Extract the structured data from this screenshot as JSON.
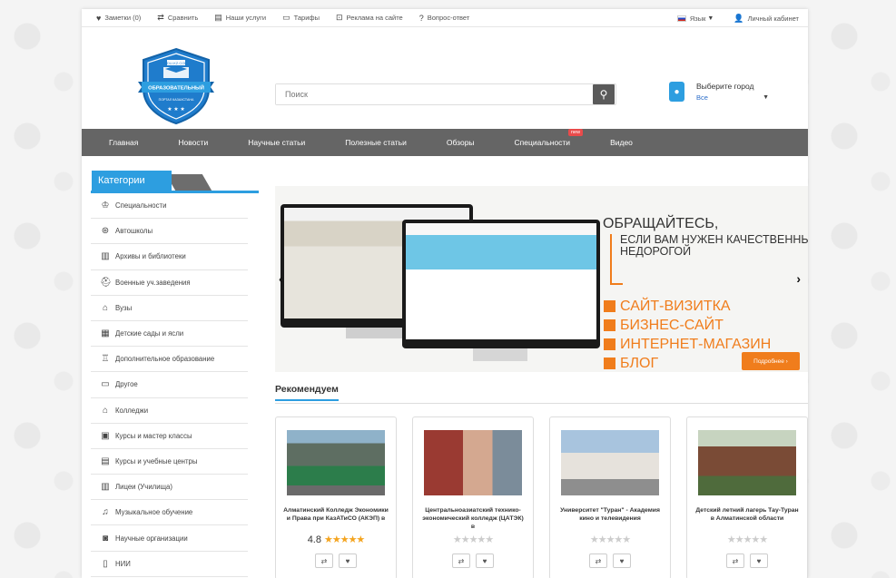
{
  "topbar": {
    "notes": "Заметки (0)",
    "compare": "Сравнить",
    "services": "Наши услуги",
    "tariffs": "Тарифы",
    "ads": "Реклама на сайте",
    "faq": "Вопрос-ответ",
    "language": "Язык",
    "cabinet": "Личный кабинет"
  },
  "logo": {
    "top": "EDU-KZ.COM",
    "ribbon": "ОБРАЗОВАТЕЛЬНЫЙ",
    "bottom": "ПОРТАЛ КАЗАХСТАНА"
  },
  "search": {
    "placeholder": "Поиск"
  },
  "city": {
    "label": "Выберите город",
    "value": "Все"
  },
  "nav": {
    "items": [
      "Главная",
      "Новости",
      "Научные статьи",
      "Полезные статьи",
      "Обзоры",
      "Специальности",
      "Видео"
    ],
    "badge": "new"
  },
  "sidebar": {
    "title": "Категории",
    "items": [
      "Специальности",
      "Автошколы",
      "Архивы и библиотеки",
      "Военные уч.заведения",
      "Вузы",
      "Детские сады и ясли",
      "Дополнительное образование",
      "Другое",
      "Колледжи",
      "Курсы и мастер классы",
      "Курсы и учебные центры",
      "Лицеи (Училища)",
      "Музыкальное обучение",
      "Научные организации",
      "НИИ"
    ]
  },
  "banner": {
    "title": "ОБРАЩАЙТЕСЬ,",
    "subtitle": "ЕСЛИ ВАМ НУЖЕН КАЧЕСТВЕННЫЙ НЕДОРОГОЙ",
    "list": [
      "САЙТ-ВИЗИТКА",
      "БИЗНЕС-САЙТ",
      "ИНТЕРНЕТ-МАГАЗИН",
      "БЛОГ"
    ],
    "button": "Подробнее ›"
  },
  "recommend": {
    "title": "Рекомендуем",
    "cards": [
      {
        "name": "Алматинский Колледж Экономики и Права при КазАТиСО (АКЭП) в",
        "rating": "4.8",
        "stars": 5
      },
      {
        "name": "Центральноазиатский технико-экономический колледж (ЦАТЭК) в",
        "rating": "",
        "stars": 0
      },
      {
        "name": "Университет \"Туран\" - Академия кино и телевидения",
        "rating": "",
        "stars": 0
      },
      {
        "name": "Детский летний лагерь Тау-Туран в Алматинской области",
        "rating": "",
        "stars": 0
      }
    ]
  },
  "colors": {
    "accent": "#2d9ee0",
    "nav": "#656565",
    "orange": "#f07d1c"
  }
}
